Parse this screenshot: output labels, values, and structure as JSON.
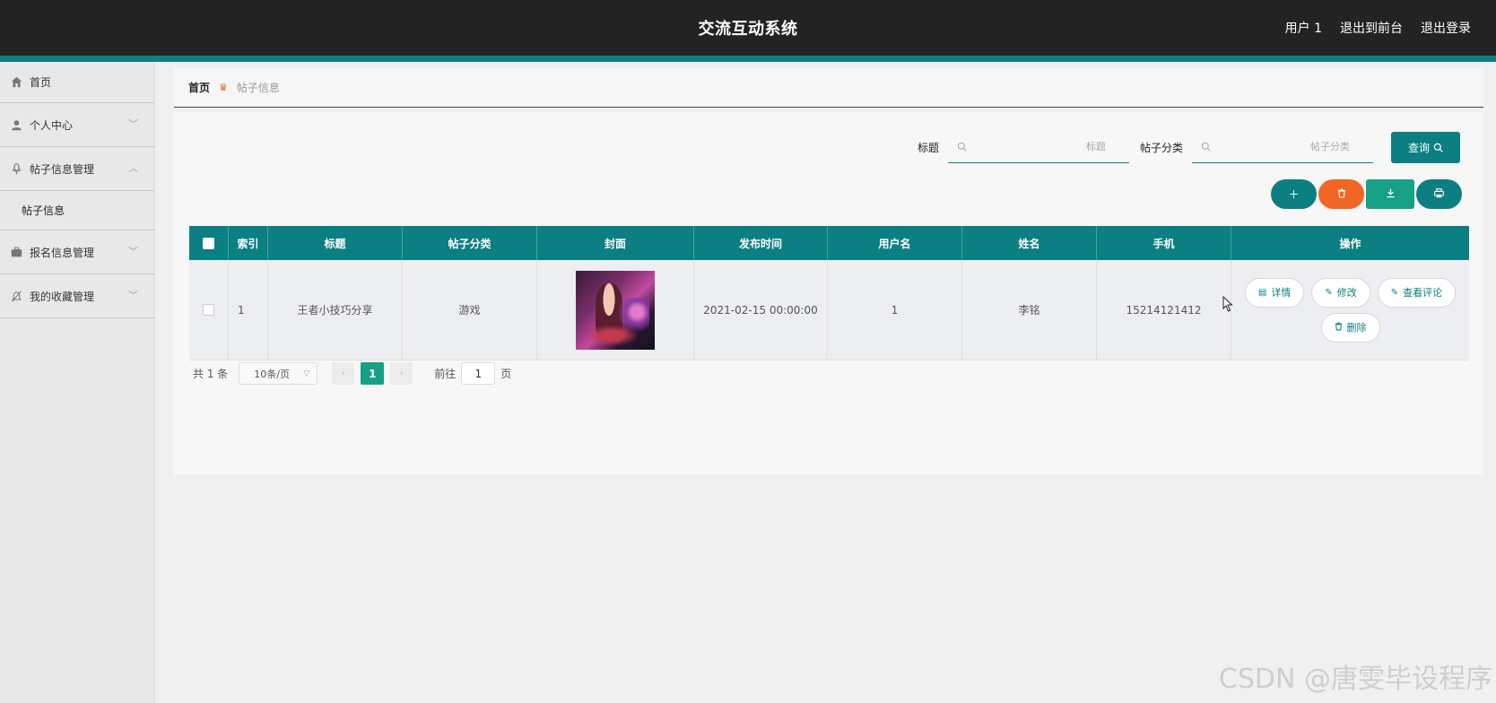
{
  "header": {
    "title": "交流互动系统",
    "user": "用户 1",
    "front_link": "退出到前台",
    "logout_link": "退出登录"
  },
  "sidebar": {
    "items": [
      {
        "label": "首页",
        "icon": "home-icon"
      },
      {
        "label": "个人中心",
        "icon": "user-icon"
      },
      {
        "label": "帖子信息管理",
        "icon": "mic-icon",
        "expanded": true,
        "children": [
          {
            "label": "帖子信息"
          }
        ]
      },
      {
        "label": "报名信息管理",
        "icon": "briefcase-icon"
      },
      {
        "label": "我的收藏管理",
        "icon": "bell-off-icon"
      }
    ]
  },
  "breadcrumb": {
    "home": "首页",
    "current": "帖子信息"
  },
  "search": {
    "title_label": "标题",
    "title_placeholder": "标题",
    "category_label": "帖子分类",
    "category_placeholder": "帖子分类",
    "query_button": "查询"
  },
  "table": {
    "headers": [
      "索引",
      "标题",
      "帖子分类",
      "封面",
      "发布时间",
      "用户名",
      "姓名",
      "手机",
      "操作"
    ],
    "rows": [
      {
        "index": "1",
        "title": "王者小技巧分享",
        "category": "游戏",
        "publish_time": "2021-02-15 00:00:00",
        "username": "1",
        "name": "李铭",
        "phone": "15214121412"
      }
    ],
    "row_actions": {
      "detail": "详情",
      "edit": "修改",
      "comments": "查看评论",
      "delete": "删除"
    }
  },
  "pagination": {
    "total": "共 1 条",
    "page_size": "10条/页",
    "current_page": "1",
    "goto_label": "前往",
    "goto_value": "1",
    "page_suffix": "页"
  },
  "watermark": "CSDN @唐雯毕设程序",
  "colors": {
    "accent": "#0b7f82",
    "danger": "#f26522",
    "success": "#16a085",
    "header_bg": "#232323"
  }
}
